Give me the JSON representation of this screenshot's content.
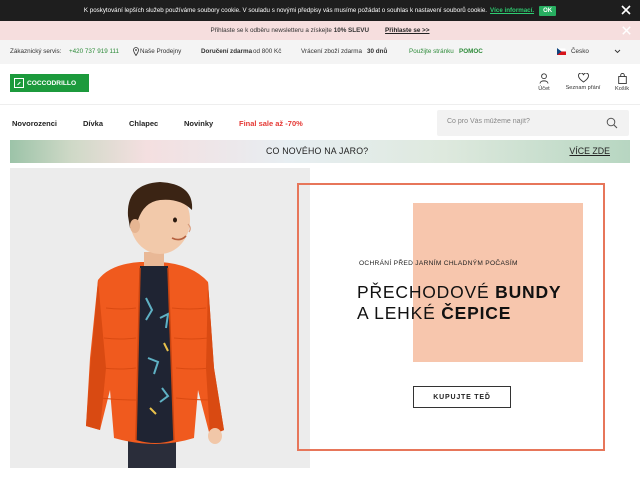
{
  "cookie": {
    "text": "K poskytování lepších služeb používáme soubory cookie. V souladu s novými předpisy vás musíme požádat o souhlas k nastavení souborů cookie.",
    "more_link": "Více informací.",
    "ok_button": "OK"
  },
  "newsletter": {
    "text": "Přihlaste se k odběru newsletteru a získejte",
    "discount": "10% SLEVU",
    "signup_link": "Přihlaste se >>"
  },
  "info_bar": {
    "service_label": "Zákaznický servis:",
    "phone": "+420 737 919 111",
    "stores": "Naše Prodejny",
    "delivery_bold": "Doručení zdarma",
    "delivery_rest": "od 800 Kč",
    "returns_text": "Vrácení zboží zdarma",
    "returns_days": "30 dnů",
    "promo_text": "Použijte stránku",
    "promo_code": "POMOC",
    "country": "Česko"
  },
  "header": {
    "logo_text": "COCCODRILLO",
    "account": "Účet",
    "wishlist": "Seznam přání",
    "cart": "Košík"
  },
  "nav": {
    "items": [
      "Novorozenci",
      "Dívka",
      "Chlapec",
      "Novinky",
      "Final sale až -70%"
    ]
  },
  "search": {
    "placeholder": "Co pro Vás můžeme najít?"
  },
  "promo": {
    "text": "CO NOVÉHO NA JARO?",
    "link": "VÍCE ZDE"
  },
  "hero": {
    "subtitle": "OCHRÁNÍ PŘED JARNÍM CHLADNÝM POČASÍM",
    "line1_regular": "PŘECHODOVÉ",
    "line1_bold": "BUNDY",
    "line2_regular": "A LEHKÉ",
    "line2_bold": "ČEPICE",
    "button": "KUPUJTE TEĎ"
  },
  "colors": {
    "brand_green": "#1c9a3c",
    "sale_red": "#e53935",
    "accent_orange": "#e7765a",
    "peach": "#f7c6ad",
    "cookie_bg": "#1e1e1e",
    "newsletter_bg": "#f6dede"
  },
  "icons": [
    "close-icon",
    "map-pin-icon",
    "czech-flag-icon",
    "chevron-down-icon",
    "user-icon",
    "heart-icon",
    "shopping-bag-icon",
    "search-icon"
  ]
}
